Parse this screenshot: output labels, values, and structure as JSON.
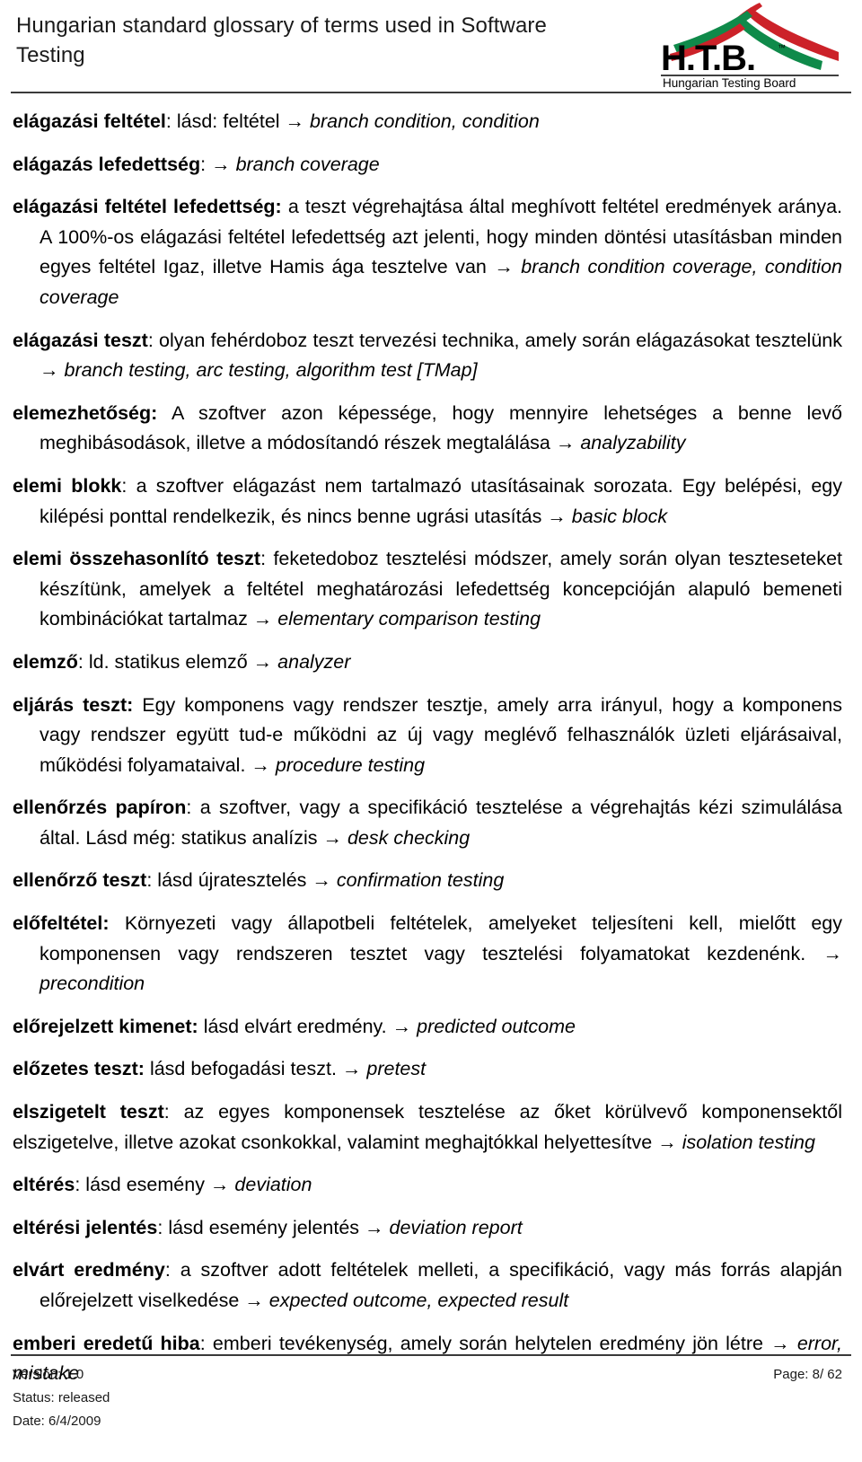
{
  "document": {
    "header": {
      "title": "Hungarian standard glossary of terms used in Software Testing",
      "logo": {
        "name": "htb-logo",
        "acronym": "H.T.B.",
        "trademark": "™",
        "subtitle": "Hungarian Testing Board",
        "colors": {
          "red": "#cc2229",
          "green": "#0f8a4a",
          "black": "#000000"
        }
      }
    },
    "entries": [
      {
        "id": "elagazasi-feltetel",
        "term": "elágazási feltétel",
        "separator": ": ",
        "body": "lásd: feltétel",
        "arrow": " → ",
        "english": "branch condition, condition",
        "indent": true
      },
      {
        "id": "elagazas-lefedettseg",
        "term": "elágazás lefedettség",
        "separator": ": ",
        "body": "",
        "arrow": "→ ",
        "english": "branch coverage",
        "indent": true
      },
      {
        "id": "elagazasi-feltetel-lefedettseg",
        "term": "elágazási feltétel lefedettség:",
        "separator": " ",
        "body": "a teszt végrehajtása által meghívott feltétel eredmények aránya. A 100%-os elágazási feltétel lefedettség azt jelenti, hogy minden döntési utasításban minden egyes feltétel Igaz, illetve Hamis ága tesztelve van",
        "arrow": " → ",
        "english": "branch condition coverage, condition coverage",
        "indent": true
      },
      {
        "id": "elagazasi-teszt",
        "term": "elágazási teszt",
        "separator": ": ",
        "body": "olyan fehérdoboz teszt tervezési technika, amely során elágazásokat tesztelünk",
        "arrow": " → ",
        "english": "branch testing, arc testing, algorithm test [TMap]",
        "indent": true
      },
      {
        "id": "elemezhetoseg",
        "term": "elemezhetőség:",
        "separator": " ",
        "body": "A szoftver azon képessége, hogy mennyire lehetséges a benne levő meghibásodások, illetve a módosítandó részek megtalálása",
        "arrow": " → ",
        "english": "analyzability",
        "indent": true
      },
      {
        "id": "elemi-blokk",
        "term": "elemi blokk",
        "separator": ": ",
        "body": "a szoftver elágazást nem tartalmazó utasításainak sorozata. Egy belépési, egy kilépési ponttal rendelkezik, és nincs benne ugrási utasítás",
        "arrow": " → ",
        "english": "basic block",
        "indent": true
      },
      {
        "id": "elemi-osszehasonlito-teszt",
        "term": "elemi összehasonlító teszt",
        "separator": ": ",
        "body": "feketedoboz tesztelési módszer, amely során olyan teszteseteket készítünk, amelyek a feltétel meghatározási lefedettség koncepcióján alapuló bemeneti kombinációkat tartalmaz",
        "arrow": " → ",
        "english": "elementary comparison testing",
        "indent": true
      },
      {
        "id": "elemzo",
        "term": "elemző",
        "separator": ": ",
        "body": "ld. statikus elemző",
        "arrow": " → ",
        "english": "analyzer",
        "indent": true
      },
      {
        "id": "eljaras-teszt",
        "term": "eljárás teszt:",
        "separator": " ",
        "body": "Egy komponens vagy rendszer tesztje, amely arra irányul, hogy a komponens vagy rendszer együtt tud-e működni az új vagy meglévő felhasználók üzleti eljárásaival, működési folyamataival.",
        "arrow": " → ",
        "english": "procedure testing",
        "indent": true
      },
      {
        "id": "ellenorzes-papiron",
        "term": "ellenőrzés papíron",
        "separator": ": ",
        "body": "a szoftver, vagy a specifikáció tesztelése a végrehajtás kézi szimulálása által. Lásd még: statikus analízis",
        "arrow": " → ",
        "english": "desk checking",
        "indent": true
      },
      {
        "id": "ellenorzo-teszt",
        "term": "ellenőrző teszt",
        "separator": ": ",
        "body": "lásd újratesztelés",
        "arrow": " → ",
        "english": "confirmation testing",
        "indent": true
      },
      {
        "id": "elofeltetel",
        "term": "előfeltétel:",
        "separator": " ",
        "body": "Környezeti vagy állapotbeli feltételek, amelyeket teljesíteni kell, mielőtt egy komponensen vagy rendszeren tesztet vagy tesztelési folyamatokat kezdenénk.",
        "arrow": " → ",
        "english": "precondition",
        "indent": true
      },
      {
        "id": "elorejelzett-kimenet",
        "term": "előrejelzett kimenet:",
        "separator": " ",
        "body": "lásd elvárt eredmény.",
        "arrow": " → ",
        "english": "predicted outcome",
        "indent": true
      },
      {
        "id": "elozetes-teszt",
        "term": "előzetes teszt:",
        "separator": " ",
        "body": "lásd befogadási teszt.",
        "arrow": " → ",
        "english": "pretest",
        "indent": true
      },
      {
        "id": "elszigetelt-teszt",
        "term": "elszigetelt teszt",
        "separator": ": ",
        "body": "az egyes komponensek tesztelése az őket körülvevő komponensektől elszigetelve, illetve azokat csonkokkal, valamint meghajtókkal helyettesítve",
        "arrow": " → ",
        "english": "isolation testing",
        "indent": false
      },
      {
        "id": "elteres",
        "term": "eltérés",
        "separator": ": ",
        "body": "lásd esemény",
        "arrow": " → ",
        "english": "deviation",
        "indent": true
      },
      {
        "id": "elteresi-jelentes",
        "term": "eltérési jelentés",
        "separator": ": ",
        "body": "lásd esemény jelentés",
        "arrow": " → ",
        "english": "deviation report",
        "indent": true
      },
      {
        "id": "elvart-eredmeny",
        "term": "elvárt eredmény",
        "separator": ": ",
        "body": "a szoftver adott feltételek melleti, a specifikáció, vagy más forrás alapján előrejelzett viselkedése",
        "arrow": " → ",
        "english": "expected outcome, expected result",
        "indent": true
      },
      {
        "id": "emberi-eredetu-hiba",
        "term": "emberi eredetű hiba",
        "separator": ": ",
        "body": "emberi tevékenység, amely során helytelen eredmény jön létre",
        "arrow": " → ",
        "english": "error, mistake",
        "indent": false
      }
    ],
    "footer": {
      "version": "Version: 1.0",
      "status": "Status: released",
      "date": "Date: 6/4/2009",
      "page": "Page: 8/ 62"
    }
  }
}
